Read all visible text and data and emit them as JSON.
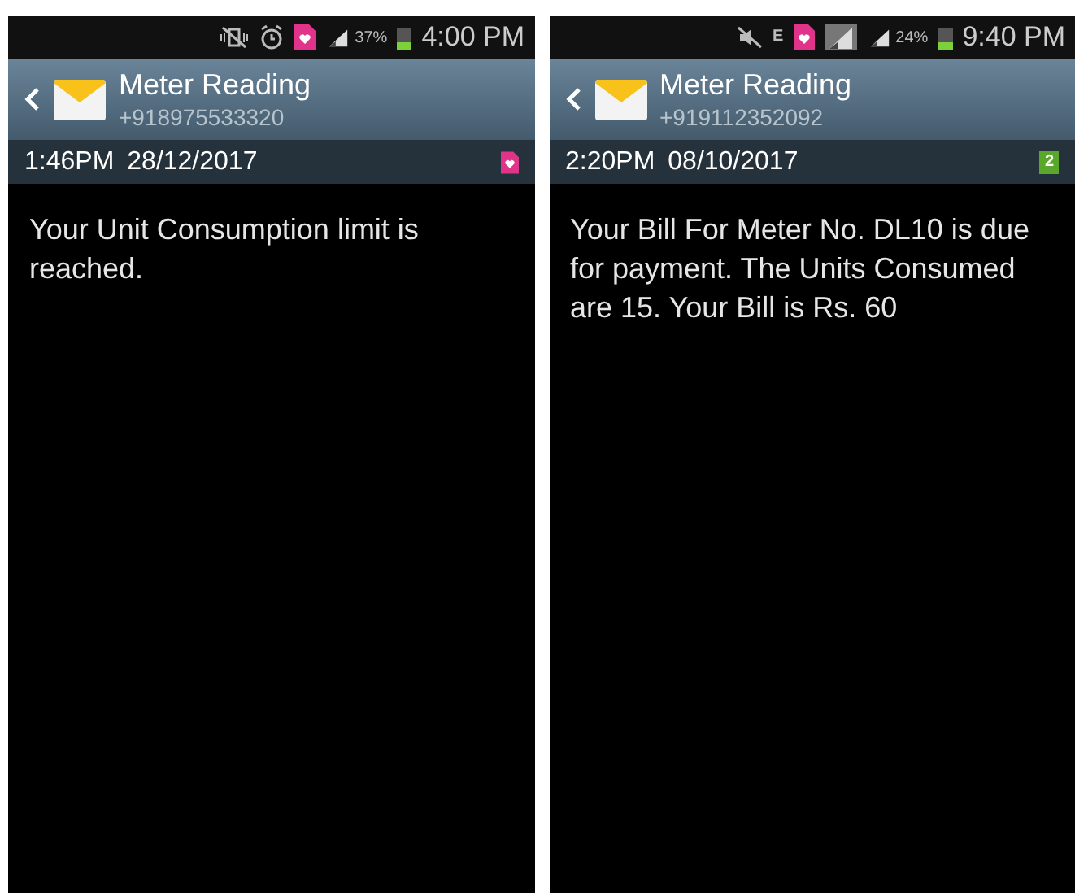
{
  "phones": [
    {
      "status_bar": {
        "icons": [
          {
            "kind": "vibrate"
          },
          {
            "kind": "alarm"
          },
          {
            "kind": "sim"
          },
          {
            "kind": "signal"
          }
        ],
        "battery_percent": "37%",
        "time": "4:00 PM"
      },
      "header": {
        "title": "Meter Reading",
        "number": "+918975533320"
      },
      "message_bar": {
        "time": "1:46PM",
        "date": "28/12/2017",
        "sim": {
          "kind": "heart"
        }
      },
      "body": "Your Unit Consumption limit is reached."
    },
    {
      "status_bar": {
        "icons": [
          {
            "kind": "mute"
          },
          {
            "kind": "data",
            "label": "E"
          },
          {
            "kind": "sim"
          },
          {
            "kind": "signal-box"
          },
          {
            "kind": "signal"
          }
        ],
        "battery_percent": "24%",
        "time": "9:40 PM"
      },
      "header": {
        "title": "Meter Reading",
        "number": "+919112352092"
      },
      "message_bar": {
        "time": "2:20PM",
        "date": "08/10/2017",
        "sim": {
          "kind": "number",
          "label": "2"
        }
      },
      "body": "Your Bill For Meter No. DL10 is due for payment. The Units Consumed are 15. Your Bill is Rs. 60"
    }
  ]
}
